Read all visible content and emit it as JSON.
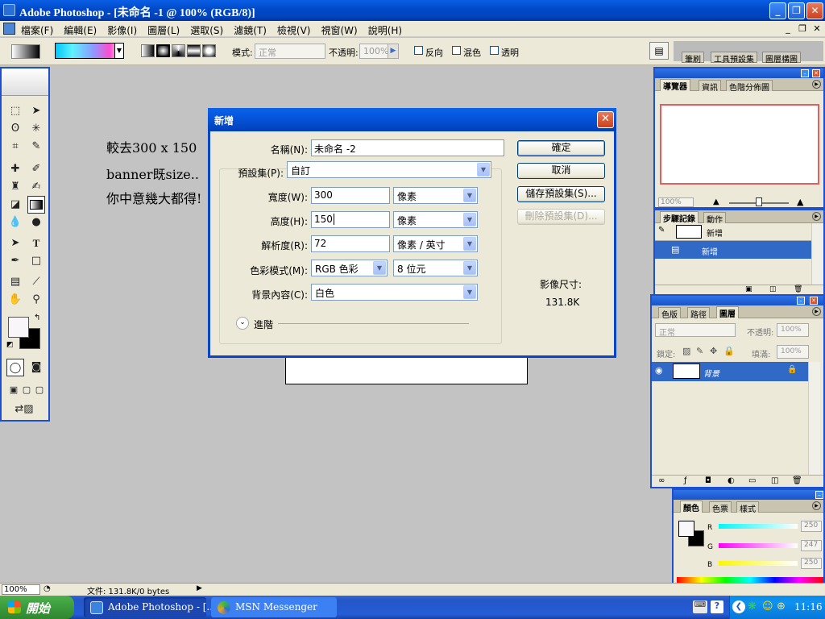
{
  "titlebar": {
    "title": "Adobe Photoshop - [未命名 -1 @ 100% (RGB/8)]",
    "minimize_glyph": "_",
    "restore_glyph": "❐",
    "close_glyph": "✕"
  },
  "menubar": {
    "items": [
      "檔案(F)",
      "編輯(E)",
      "影像(I)",
      "圖層(L)",
      "選取(S)",
      "濾鏡(T)",
      "檢視(V)",
      "視窗(W)",
      "說明(H)"
    ],
    "doc_minimize": "_",
    "doc_restore": "❐",
    "doc_close": "✕"
  },
  "options": {
    "mode_label": "模式:",
    "mode_value": "正常",
    "opacity_label": "不透明:",
    "opacity_value": "100%",
    "reverse_label": "反向",
    "dither_label": "混色",
    "transparency_label": "透明",
    "well_tabs": [
      "筆刷",
      "工具預設集",
      "圖層構圖"
    ]
  },
  "canvas_text": {
    "line1": "較去300 x 150",
    "line2": "banner既size..",
    "line3": "你中意幾大都得!"
  },
  "dialog": {
    "title": "新增",
    "name_label": "名稱(N):",
    "name_value": "未命名 -2",
    "preset_label": "預設集(P):",
    "preset_value": "自訂",
    "width_label": "寬度(W):",
    "width_value": "300",
    "width_unit": "像素",
    "height_label": "高度(H):",
    "height_value": "150",
    "height_unit": "像素",
    "resolution_label": "解析度(R):",
    "resolution_value": "72",
    "resolution_unit": "像素 / 英寸",
    "color_mode_label": "色彩模式(M):",
    "color_mode_value": "RGB 色彩",
    "bit_depth_value": "8 位元",
    "background_label": "背景內容(C):",
    "background_value": "白色",
    "advanced_label": "進階",
    "ok_label": "確定",
    "cancel_label": "取消",
    "save_preset_label": "儲存預設集(S)...",
    "delete_preset_label": "刪除預設集(D)...",
    "image_size_label": "影像尺寸:",
    "image_size_value": "131.8K"
  },
  "navigator": {
    "tabs": [
      "導覽器",
      "資訊",
      "色階分佈圖"
    ],
    "zoom": "100%"
  },
  "history": {
    "tabs": [
      "步驟記錄",
      "動作"
    ],
    "snapshot_label": "新增",
    "step_label": "新增"
  },
  "layers": {
    "tabs": [
      "色版",
      "路徑",
      "圖層"
    ],
    "blend_mode": "正常",
    "opacity_label": "不透明:",
    "opacity_value": "100%",
    "lock_label": "鎖定:",
    "fill_label": "填滿:",
    "fill_value": "100%",
    "layer_name": "背景"
  },
  "color": {
    "tabs": [
      "顏色",
      "色票",
      "樣式"
    ],
    "r_label": "R",
    "g_label": "G",
    "b_label": "B",
    "r_value": "250",
    "g_value": "247",
    "b_value": "250"
  },
  "status": {
    "zoom": "100%",
    "doc_info": "文件: 131.8K/0 bytes"
  },
  "taskbar": {
    "start_label": "開始",
    "task1": "Adobe Photoshop - [...",
    "task2": "MSN Messenger",
    "clock": "11:16"
  }
}
